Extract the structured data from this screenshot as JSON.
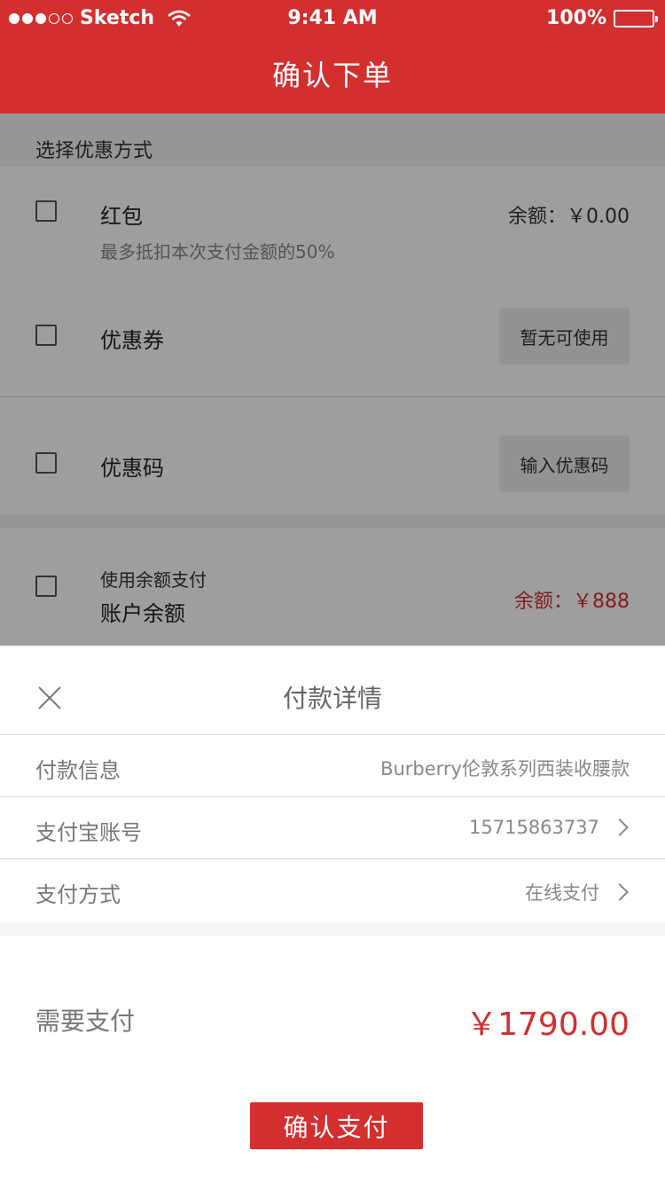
{
  "status_bar": {
    "carrier": "Sketch",
    "time": "9:41 AM",
    "battery": "100%"
  },
  "nav": {
    "title": "确认下单"
  },
  "discount": {
    "section_label": "选择优惠方式",
    "red_packet": {
      "title": "红包",
      "subtitle": "最多抵扣本次支付金额的50%",
      "balance": "余额：￥0.00"
    },
    "coupon": {
      "title": "优惠券",
      "button": "暂无可使用"
    },
    "promo_code": {
      "title": "优惠码",
      "button": "输入优惠码"
    },
    "account_balance": {
      "subtitle": "使用余额支付",
      "title": "账户余额",
      "balance": "余额：￥888"
    }
  },
  "payment_sheet": {
    "title": "付款详情",
    "rows": [
      {
        "label": "付款信息",
        "value": "Burberry伦敦系列西装收腰款"
      },
      {
        "label": "支付宝账号",
        "value": "15715863737"
      },
      {
        "label": "支付方式",
        "value": "在线支付"
      }
    ],
    "need_label": "需要支付",
    "need_amount": "￥1790.00",
    "confirm_button": "确认支付"
  },
  "colors": {
    "brand": "#d32f2f"
  }
}
